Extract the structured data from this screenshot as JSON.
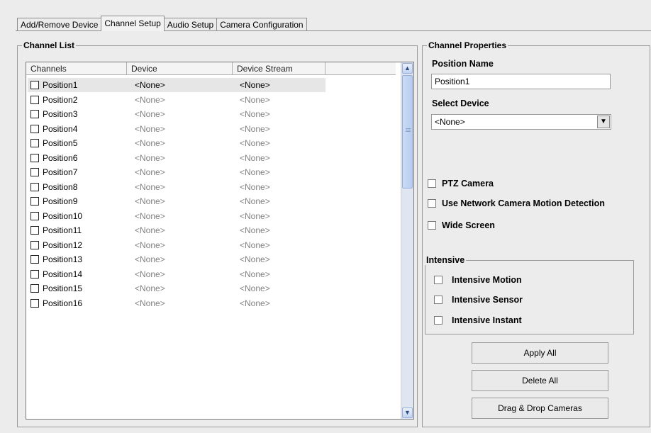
{
  "tabs": [
    "Add/Remove Device",
    "Channel Setup",
    "Audio Setup",
    "Camera Configuration"
  ],
  "channel_list": {
    "title": "Channel List",
    "columns": [
      "Channels",
      "Device",
      "Device Stream"
    ],
    "rows": [
      {
        "channel": "Position1",
        "device": "<None>",
        "stream": "<None>"
      },
      {
        "channel": "Position2",
        "device": "<None>",
        "stream": "<None>"
      },
      {
        "channel": "Position3",
        "device": "<None>",
        "stream": "<None>"
      },
      {
        "channel": "Position4",
        "device": "<None>",
        "stream": "<None>"
      },
      {
        "channel": "Position5",
        "device": "<None>",
        "stream": "<None>"
      },
      {
        "channel": "Position6",
        "device": "<None>",
        "stream": "<None>"
      },
      {
        "channel": "Position7",
        "device": "<None>",
        "stream": "<None>"
      },
      {
        "channel": "Position8",
        "device": "<None>",
        "stream": "<None>"
      },
      {
        "channel": "Position9",
        "device": "<None>",
        "stream": "<None>"
      },
      {
        "channel": "Position10",
        "device": "<None>",
        "stream": "<None>"
      },
      {
        "channel": "Position11",
        "device": "<None>",
        "stream": "<None>"
      },
      {
        "channel": "Position12",
        "device": "<None>",
        "stream": "<None>"
      },
      {
        "channel": "Position13",
        "device": "<None>",
        "stream": "<None>"
      },
      {
        "channel": "Position14",
        "device": "<None>",
        "stream": "<None>"
      },
      {
        "channel": "Position15",
        "device": "<None>",
        "stream": "<None>"
      },
      {
        "channel": "Position16",
        "device": "<None>",
        "stream": "<None>"
      }
    ]
  },
  "properties": {
    "title": "Channel Properties",
    "position_name_label": "Position Name",
    "position_name_value": "Position1",
    "select_device_label": "Select Device",
    "select_device_value": "<None>",
    "ptz_label": "PTZ Camera",
    "motion_label": "Use Network Camera  Motion Detection",
    "wide_label": "Wide Screen",
    "intensive": {
      "title": "Intensive",
      "motion": "Intensive Motion",
      "sensor": "Intensive Sensor",
      "instant": "Intensive Instant"
    },
    "buttons": {
      "apply_all": "Apply All",
      "delete_all": "Delete All",
      "drag_drop": "Drag & Drop Cameras"
    }
  }
}
